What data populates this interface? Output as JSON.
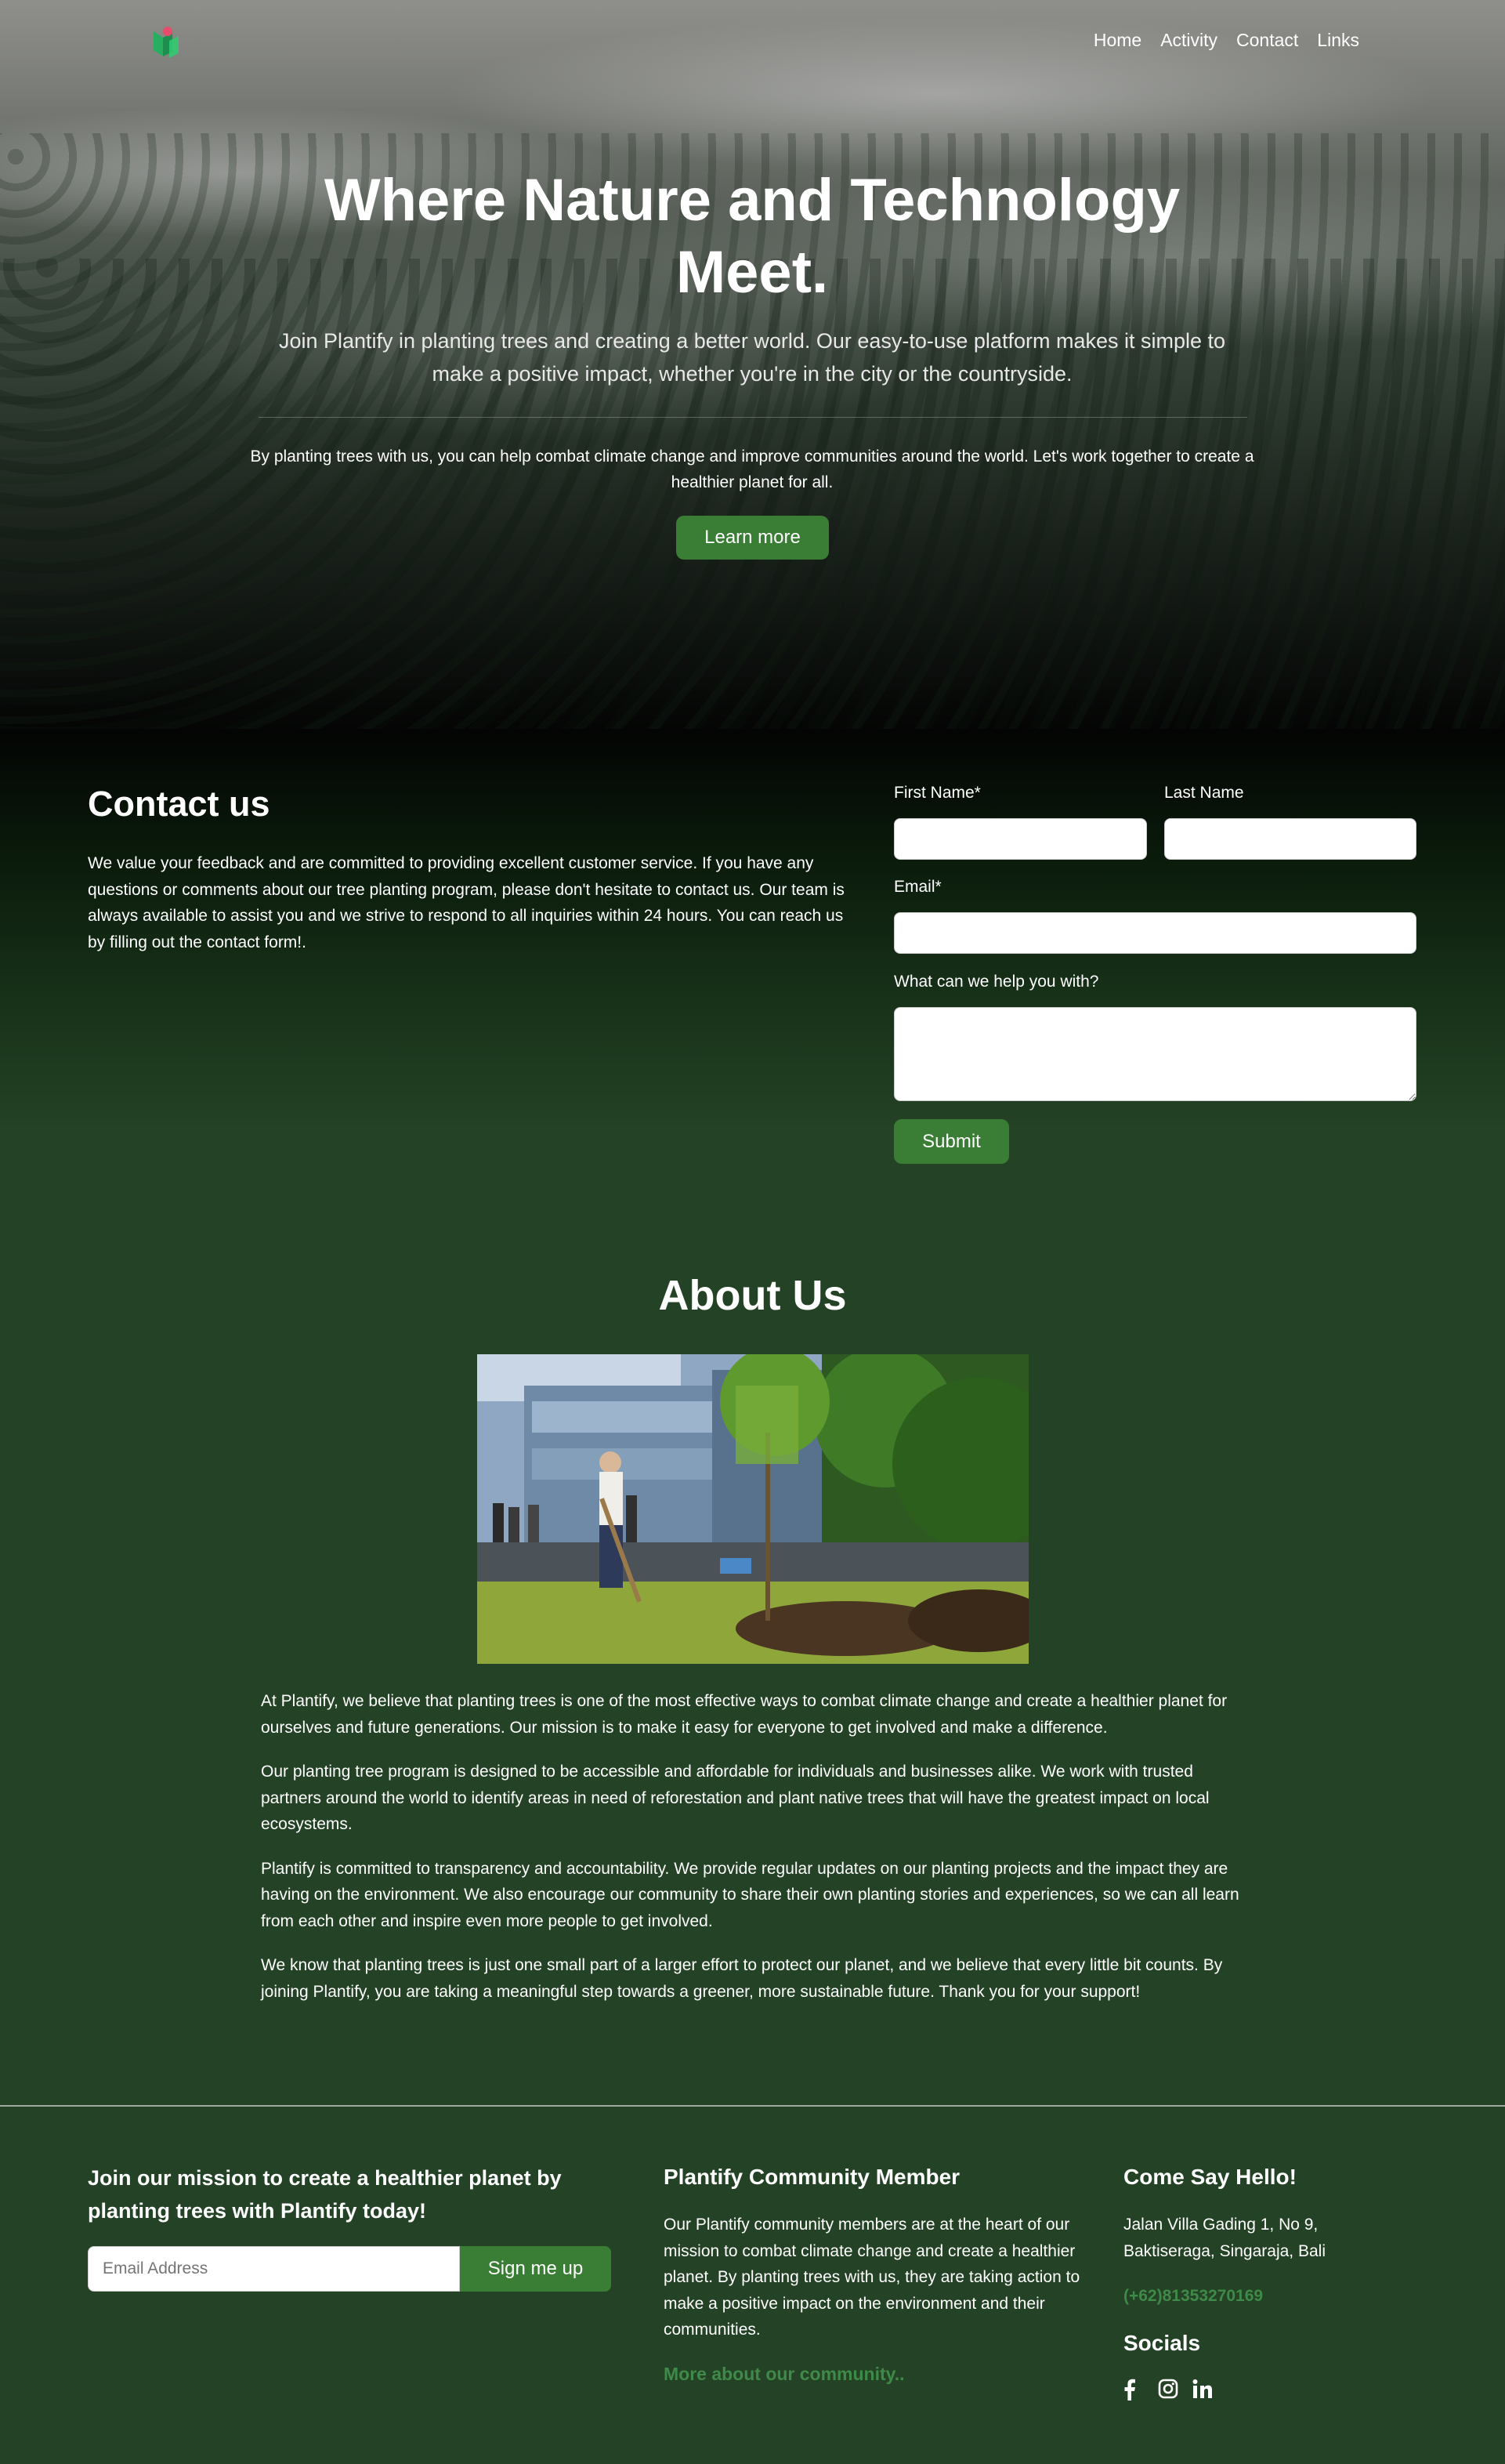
{
  "nav": {
    "items": [
      "Home",
      "Activity",
      "Contact",
      "Links"
    ]
  },
  "hero": {
    "title": "Where Nature and Technology Meet.",
    "subtitle": "Join Plantify in planting trees and creating a better world. Our easy-to-use platform makes it simple to make a positive impact, whether you're in the city or the countryside.",
    "body": "By planting trees with us, you can help combat climate change and improve communities around the world. Let's work together to create a healthier planet for all.",
    "button": "Learn more"
  },
  "contact": {
    "title": "Contact us",
    "text": "We value your feedback and are committed to providing excellent customer service. If you have any questions or comments about our tree planting program, please don't hesitate to contact us. Our team is always available to assist you and we strive to respond to all inquiries within 24 hours. You can reach us by filling out the contact form!.",
    "first_name_label": "First Name*",
    "last_name_label": "Last Name",
    "email_label": "Email*",
    "message_label": "What can we help you with?",
    "first_name_value": "",
    "last_name_value": "",
    "email_value": "",
    "message_value": "",
    "submit": "Submit"
  },
  "about": {
    "title": "About Us",
    "paragraphs": [
      "At Plantify, we believe that planting trees is one of the most effective ways to combat climate change and create a healthier planet for ourselves and future generations. Our mission is to make it easy for everyone to get involved and make a difference.",
      "Our planting tree program is designed to be accessible and affordable for individuals and businesses alike. We work with trusted partners around the world to identify areas in need of reforestation and plant native trees that will have the greatest impact on local ecosystems.",
      "Plantify is committed to transparency and accountability. We provide regular updates on our planting projects and the impact they are having on the environment. We also encourage our community to share their own planting stories and experiences, so we can all learn from each other and inspire even more people to get involved.",
      "We know that planting trees is just one small part of a larger effort to protect our planet, and we believe that every little bit counts. By joining Plantify, you are taking a meaningful step towards a greener, more sustainable future. Thank you for your support!"
    ]
  },
  "footer": {
    "join_text": "Join our mission to create a healthier planet by planting trees with Plantify today!",
    "email_placeholder": "Email Address",
    "signup_button": "Sign me up",
    "community_title": "Plantify Community Member",
    "community_text": "Our Plantify community members are at the heart of our mission to combat climate change and create a healthier planet. By planting trees with us, they are taking action to make a positive impact on the environment and their communities.",
    "community_link": "More about our community..",
    "hello_title": "Come Say Hello!",
    "address": "Jalan Villa Gading 1, No 9, Baktiseraga, Singaraja, Bali",
    "phone": "(+62)81353270169",
    "socials_title": "Socials",
    "social_icons": [
      "facebook-icon",
      "instagram-icon",
      "linkedin-icon"
    ]
  },
  "colors": {
    "accent": "#3a7d34",
    "link": "#3f8a48",
    "background": "#244225"
  }
}
